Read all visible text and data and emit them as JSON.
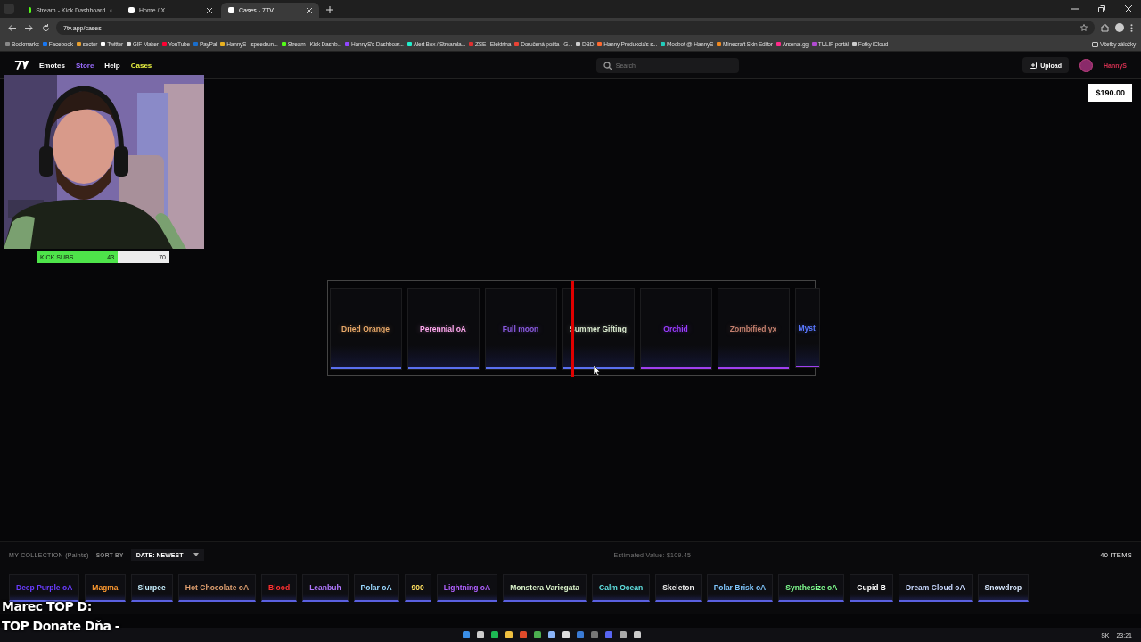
{
  "browser": {
    "tabs": [
      {
        "title": "Stream - Kick Dashboard",
        "selected": false,
        "kind": "kick"
      },
      {
        "title": "Home / X",
        "selected": false,
        "kind": "x"
      },
      {
        "title": "Cases - 7TV",
        "selected": true,
        "kind": "seventv"
      }
    ],
    "address": "7tv.app/cases",
    "bookmarks": [
      "Bookmarks",
      "Facebook",
      "sector",
      "Twitter",
      "GIF Maker",
      "YouTube",
      "PayPal",
      "HannyS - speedrun...",
      "Stream - Kick Dashb...",
      "HannyS's Dashboar...",
      "Alert Box / Streamla...",
      "ZSE | Elektrina",
      "Doručená pošta - G...",
      "DBD",
      "Hanny Produkcia's s...",
      "Moobot @ HannyS",
      "Minecraft Skin Editor",
      "Arsenal.gg",
      "TULIP portál",
      "Fotky iCloud"
    ],
    "all_bookmarks": "Všetky záložky"
  },
  "site_nav": {
    "links": [
      {
        "label": "Emotes",
        "color": "#ffffff"
      },
      {
        "label": "Store",
        "color": "#9a6cff"
      },
      {
        "label": "Help",
        "color": "#ffffff"
      },
      {
        "label": "Cases",
        "color": "#e8f040"
      }
    ],
    "search": {
      "placeholder": "Search"
    },
    "upload": "Upload",
    "user": "HannyS"
  },
  "balance": "$190.00",
  "reel": [
    {
      "name": "Dried Orange",
      "color": "#e8a868"
    },
    {
      "name": "Perennial oA",
      "color": "#ffa8ee"
    },
    {
      "name": "Full moon",
      "color": "#8a5ae0"
    },
    {
      "name": "Summer Gifting",
      "color": "#dcecd0"
    },
    {
      "name": "Orchid",
      "color": "#9a3cff"
    },
    {
      "name": "Zombified yx",
      "color": "#c4806e"
    },
    {
      "name": "Myst",
      "color": "#5a78ff"
    }
  ],
  "collection": {
    "title": "MY COLLECTION (Paints)",
    "sort_label": "SORT BY",
    "sort_value": "DATE: NEWEST",
    "estimated": "Estimated Value: $109.45",
    "count": "40 ITEMS",
    "items": [
      {
        "name": "Deep Purple oA",
        "color": "#6a3cff"
      },
      {
        "name": "Magma",
        "color": "#ff9a30"
      },
      {
        "name": "Slurpee",
        "color": "#c8f0ff"
      },
      {
        "name": "Hot Chocolate oA",
        "color": "#e0a070"
      },
      {
        "name": "Blood",
        "color": "#ff3030"
      },
      {
        "name": "Leanbuh",
        "color": "#b078ff"
      },
      {
        "name": "Polar oA",
        "color": "#9ad8ff"
      },
      {
        "name": "900",
        "color": "#ffe060"
      },
      {
        "name": "Lightning oA",
        "color": "#b060ff"
      },
      {
        "name": "Monstera Variegata",
        "color": "#d8f0c8"
      },
      {
        "name": "Calm Ocean",
        "color": "#60e0e0"
      },
      {
        "name": "Skeleton",
        "color": "#f0f0f0"
      },
      {
        "name": "Polar Brisk oA",
        "color": "#80c8ff"
      },
      {
        "name": "Synthesize oA",
        "color": "#80ff90"
      },
      {
        "name": "Cupid B",
        "color": "#ffffff"
      },
      {
        "name": "Dream Cloud oA",
        "color": "#c8d8ff"
      },
      {
        "name": "Snowdrop",
        "color": "#d8e8ff"
      }
    ]
  },
  "stream_overlay": {
    "subs_label": "KICK SUBS",
    "subs_current": "43",
    "subs_goal": "70",
    "level": 0.61,
    "donors": [
      "Marec TOP D:",
      "TOP Donate Dňa -"
    ]
  },
  "taskbar": {
    "language": "SK",
    "time": "23:21"
  }
}
